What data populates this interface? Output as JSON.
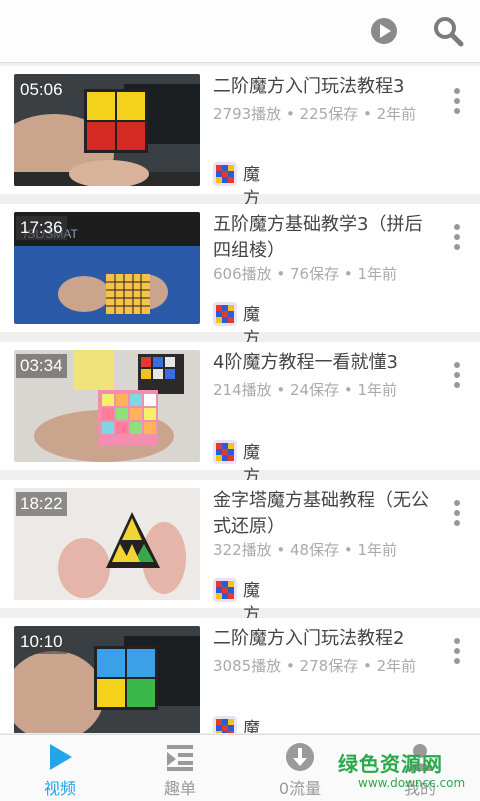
{
  "header": {
    "play_icon": "play-circle-icon",
    "search_icon": "search-icon"
  },
  "videos": [
    {
      "duration": "05:06",
      "title": "二阶魔方入门玩法教程3",
      "stats": "2793播放 • 225保存 • 2年前",
      "channel": "魔方"
    },
    {
      "duration": "17:36",
      "title": "五阶魔方基础教学3（拼后四组棱）",
      "stats": "606播放 • 76保存 • 1年前",
      "channel": "魔方"
    },
    {
      "duration": "03:34",
      "title": "4阶魔方教程一看就懂3",
      "stats": "214播放 • 24保存 • 1年前",
      "channel": "魔方"
    },
    {
      "duration": "18:22",
      "title": "金字塔魔方基础教程（无公式还原）",
      "stats": "322播放 • 48保存 • 1年前",
      "channel": "魔方"
    },
    {
      "duration": "10:10",
      "title": "二阶魔方入门玩法教程2",
      "stats": "3085播放 • 278保存 • 2年前",
      "channel": "魔方"
    }
  ],
  "tabs": [
    {
      "label": "视频",
      "icon": "play-triangle-icon",
      "active": true
    },
    {
      "label": "趣单",
      "icon": "playlist-icon",
      "active": false
    },
    {
      "label": "0流量",
      "icon": "download-icon",
      "active": false
    },
    {
      "label": "我的",
      "icon": "profile-icon",
      "active": false
    }
  ],
  "watermark": {
    "name": "绿色资源网",
    "url": "www.downcc.com"
  },
  "colors": {
    "accent": "#21a6e8",
    "text": "#444444",
    "muted": "#aaaaaa",
    "watermark": "#2aa84a"
  }
}
